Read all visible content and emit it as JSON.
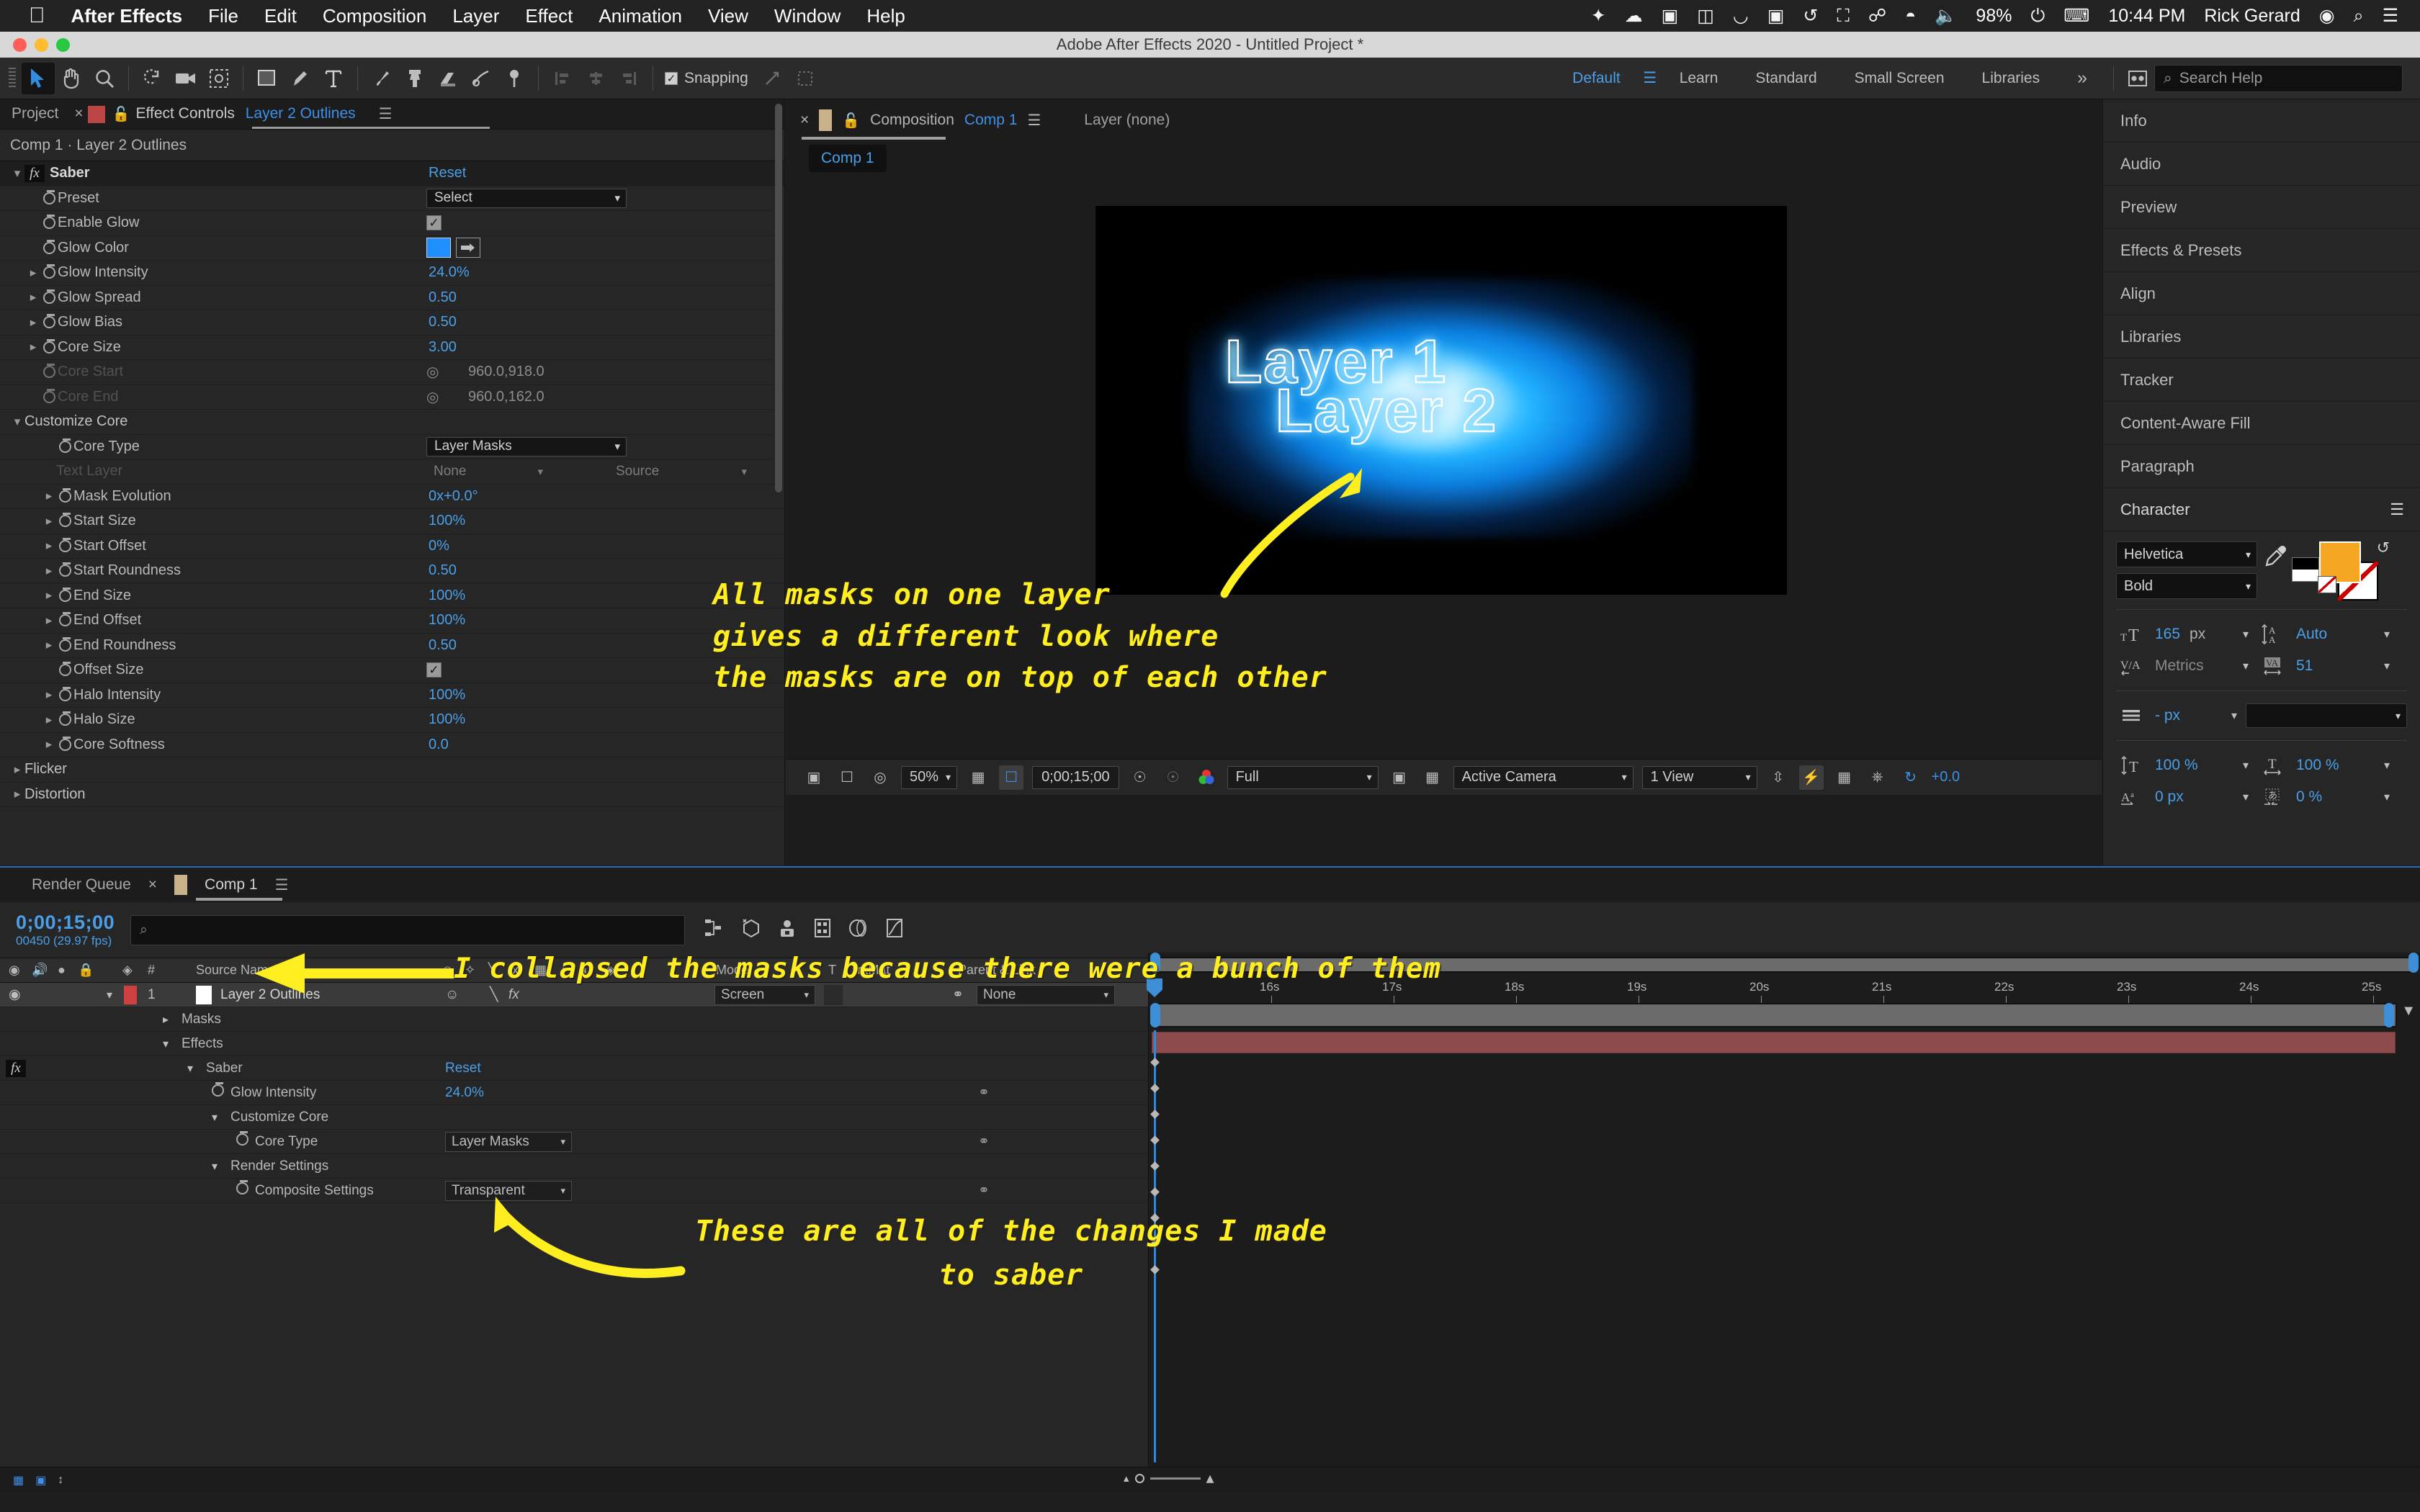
{
  "macbar": {
    "apple_icon": "apple-logo",
    "items": [
      "After Effects",
      "File",
      "Edit",
      "Composition",
      "Layer",
      "Effect",
      "Animation",
      "View",
      "Window",
      "Help"
    ],
    "right_icons": [
      "dropbox-icon",
      "creative-cloud-icon",
      "blackmagic-icon",
      "battery-gauge-icon",
      "wacom-icon",
      "display-icon",
      "timemachine-icon",
      "airplay-icon",
      "bluetooth-icon",
      "wifi-icon",
      "volume-icon"
    ],
    "battery": "98%",
    "battery_charging_icon": "battery-charging-icon",
    "keyboard_icon": "keyboard-icon",
    "time": "10:44 PM",
    "user": "Rick Gerard",
    "siri_icon": "siri-icon",
    "spotlight_icon": "search-icon",
    "controlcenter_icon": "control-center-icon"
  },
  "titlebar": {
    "title": "Adobe After Effects 2020 - Untitled Project *"
  },
  "toolbar": {
    "tools": [
      "selection-tool",
      "hand-tool",
      "zoom-tool",
      "rotation-tool",
      "camera-tool",
      "pan-behind-tool",
      "shape-tool",
      "pen-tool",
      "type-tool",
      "brush-tool",
      "clone-stamp-tool",
      "eraser-tool",
      "roto-brush-tool",
      "puppet-pin-tool"
    ],
    "snapping_label": "Snapping",
    "snapping_checked": true,
    "workspaces": [
      "Default",
      "Learn",
      "Standard",
      "Small Screen",
      "Libraries"
    ],
    "active_workspace": "Default",
    "overflow_label": "»",
    "workspace_menu_icon": "workspace-menu-icon",
    "search_placeholder": "Search Help"
  },
  "effect_controls": {
    "tabs": [
      {
        "label": "Project",
        "closable": false,
        "active": false
      },
      {
        "label": "Effect Controls Layer 2 Outlines",
        "closable": true,
        "active": true,
        "highlight": "Layer 2 Outlines"
      }
    ],
    "subtitle": "Comp 1 · Layer 2 Outlines",
    "rows": [
      {
        "indent": 0,
        "twirl": "down",
        "fx": true,
        "name": "Saber",
        "value": "Reset",
        "value_kind": "reset",
        "header": true
      },
      {
        "indent": 1,
        "stopwatch": true,
        "name": "Preset",
        "control": "select",
        "value": "Select"
      },
      {
        "indent": 1,
        "stopwatch": true,
        "name": "Enable Glow",
        "control": "checkbox",
        "checked": true
      },
      {
        "indent": 1,
        "stopwatch": true,
        "name": "Glow Color",
        "control": "color",
        "color": "#1f8fff"
      },
      {
        "indent": 1,
        "twirl": "right",
        "stopwatch": true,
        "name": "Glow Intensity",
        "value": "24.0%"
      },
      {
        "indent": 1,
        "twirl": "right",
        "stopwatch": true,
        "name": "Glow Spread",
        "value": "0.50"
      },
      {
        "indent": 1,
        "twirl": "right",
        "stopwatch": true,
        "name": "Glow Bias",
        "value": "0.50"
      },
      {
        "indent": 1,
        "twirl": "right",
        "stopwatch": true,
        "name": "Core Size",
        "value": "3.00"
      },
      {
        "indent": 1,
        "stopwatch": true,
        "name": "Core Start",
        "value": "960.0,918.0",
        "dim": true,
        "point": true
      },
      {
        "indent": 1,
        "stopwatch": true,
        "name": "Core End",
        "value": "960.0,162.0",
        "dim": true,
        "point": true
      },
      {
        "indent": 0,
        "twirl": "down",
        "name": "Customize Core",
        "group": true
      },
      {
        "indent": 2,
        "stopwatch": true,
        "name": "Core Type",
        "control": "select",
        "value": "Layer Masks"
      },
      {
        "indent": 2,
        "name": "Text Layer",
        "control": "dual-select",
        "value": "None",
        "value2": "Source",
        "dim": true
      },
      {
        "indent": 2,
        "twirl": "right",
        "stopwatch": true,
        "name": "Mask Evolution",
        "value": "0x+0.0°"
      },
      {
        "indent": 2,
        "twirl": "right",
        "stopwatch": true,
        "name": "Start Size",
        "value": "100%"
      },
      {
        "indent": 2,
        "twirl": "right",
        "stopwatch": true,
        "name": "Start Offset",
        "value": "0%"
      },
      {
        "indent": 2,
        "twirl": "right",
        "stopwatch": true,
        "name": "Start Roundness",
        "value": "0.50"
      },
      {
        "indent": 2,
        "twirl": "right",
        "stopwatch": true,
        "name": "End Size",
        "value": "100%"
      },
      {
        "indent": 2,
        "twirl": "right",
        "stopwatch": true,
        "name": "End Offset",
        "value": "100%"
      },
      {
        "indent": 2,
        "twirl": "right",
        "stopwatch": true,
        "name": "End Roundness",
        "value": "0.50"
      },
      {
        "indent": 2,
        "stopwatch": true,
        "name": "Offset Size",
        "control": "checkbox",
        "checked": true
      },
      {
        "indent": 2,
        "twirl": "right",
        "stopwatch": true,
        "name": "Halo Intensity",
        "value": "100%"
      },
      {
        "indent": 2,
        "twirl": "right",
        "stopwatch": true,
        "name": "Halo Size",
        "value": "100%"
      },
      {
        "indent": 2,
        "twirl": "right",
        "stopwatch": true,
        "name": "Core Softness",
        "value": "0.0"
      },
      {
        "indent": 0,
        "twirl": "right",
        "name": "Flicker",
        "group": true
      },
      {
        "indent": 0,
        "twirl": "right",
        "name": "Distortion",
        "group": true
      }
    ]
  },
  "composition": {
    "tab_close_icon": "close-icon",
    "tab_color_icon": "comp-color-swatch",
    "lock_icon": "lock-icon",
    "tab_label": "Composition",
    "tab_comp_name": "Comp 1",
    "tab_menu_icon": "panel-menu-icon",
    "layer_tab": "Layer (none)",
    "breadcrumb_pill": "Comp 1",
    "viewer_text_line1": "Layer 1",
    "viewer_text_line2": "Layer 2",
    "bottom_bar": {
      "toggle_icons": [
        "always-preview-icon",
        "render-toggle-icon",
        "region-of-interest-icon"
      ],
      "magnification": "50%",
      "grid_icon": "grid-guides-icon",
      "roi_icon": "region-of-interest-icon",
      "timecode": "0;00;15;00",
      "snapshot_icon": "snapshot-icon",
      "show_snapshot_icon": "show-snapshot-icon",
      "channels_icon": "show-channel-icon",
      "resolution": "Full",
      "transparency_icon": "transparency-grid-icon",
      "mask_icon": "mask-overlay-icon",
      "camera": "Active Camera",
      "views": "1 View",
      "pixel_aspect_icon": "pixel-aspect-icon",
      "fast_previews_icon": "fast-previews-icon",
      "timeline_icon": "timeline-icon",
      "comp_flowchart_icon": "comp-flowchart-icon",
      "reset_exposure_icon": "reset-exposure-icon",
      "exposure": "+0.0"
    }
  },
  "right_panels": {
    "items": [
      "Info",
      "Audio",
      "Preview",
      "Effects & Presets",
      "Align",
      "Libraries",
      "Tracker",
      "Content-Aware Fill",
      "Paragraph"
    ],
    "character": {
      "title": "Character",
      "menu_icon": "panel-menu-icon",
      "font_family": "Helvetica",
      "font_style": "Bold",
      "eyedropper_icon": "eyedropper-icon",
      "swap_icon": "swap-fill-stroke-icon",
      "fill_color": "#f5a623",
      "font_size": "165",
      "font_size_unit": "px",
      "font_size_icon": "font-size-icon",
      "leading": "Auto",
      "leading_icon": "leading-icon",
      "kerning": "Metrics",
      "kerning_icon": "kerning-icon",
      "tracking": "51",
      "tracking_icon": "tracking-icon",
      "stroke_width": "- px",
      "stroke_width_icon": "stroke-width-icon",
      "stroke_type": "",
      "vertical_scale": "100 %",
      "vertical_scale_icon": "vertical-scale-icon",
      "horizontal_scale": "100 %",
      "horizontal_scale_icon": "horizontal-scale-icon",
      "baseline_shift": "0 px",
      "baseline_shift_icon": "baseline-shift-icon",
      "tsume": "0 %",
      "tsume_icon": "tsume-icon"
    }
  },
  "timeline": {
    "tabs": [
      {
        "label": "Render Queue",
        "active": false
      },
      {
        "label": "Comp 1",
        "active": true,
        "closable": true
      }
    ],
    "tab_menu_icon": "panel-menu-icon",
    "current_time": "0;00;15;00",
    "frame_info": "00450 (29.97 fps)",
    "search_icon": "search-icon",
    "toolbar_icons": [
      "composition-mini-flowchart-icon",
      "draft-3d-icon",
      "hide-shy-layers-icon",
      "frame-blending-icon",
      "motion-blur-icon",
      "graph-editor-icon"
    ],
    "columns": [
      "Source Name",
      "Mode",
      "T",
      "TrkMat",
      "Parent & Link"
    ],
    "col_icons": [
      "video-toggle-icon",
      "audio-toggle-icon",
      "solo-icon",
      "lock-icon",
      "label-icon",
      "number-icon",
      "shy-icon",
      "collapse-icon",
      "quality-icon",
      "effects-icon",
      "frame-blend-icon",
      "motion-blur-icon",
      "adjustment-icon",
      "3d-layer-icon"
    ],
    "rows": [
      {
        "indent": 0,
        "kind": "layer",
        "number": "1",
        "name": "Layer 2 Outlines",
        "mode": "Screen",
        "parent": "None",
        "selected": true,
        "twirl": "down"
      },
      {
        "indent": 3,
        "kind": "group",
        "name": "Masks",
        "twirl": "right"
      },
      {
        "indent": 3,
        "kind": "group",
        "name": "Effects",
        "twirl": "down"
      },
      {
        "indent": 4,
        "kind": "effect",
        "name": "Saber",
        "value": "Reset",
        "value_kind": "reset",
        "twirl": "down",
        "fx": true
      },
      {
        "indent": 5,
        "kind": "prop",
        "name": "Glow Intensity",
        "value": "24.0%",
        "stopwatch": true,
        "link": true
      },
      {
        "indent": 5,
        "kind": "group",
        "name": "Customize Core",
        "twirl": "down"
      },
      {
        "indent": 6,
        "kind": "prop",
        "name": "Core Type",
        "control": "select",
        "value": "Layer Masks",
        "stopwatch": true,
        "link": true
      },
      {
        "indent": 5,
        "kind": "group",
        "name": "Render Settings",
        "twirl": "down"
      },
      {
        "indent": 6,
        "kind": "prop",
        "name": "Composite Settings",
        "control": "select",
        "value": "Transparent",
        "stopwatch": true,
        "link": true
      }
    ],
    "ruler_ticks": [
      "16s",
      "17s",
      "18s",
      "19s",
      "20s",
      "21s",
      "22s",
      "23s",
      "24s",
      "25s"
    ],
    "status_icons": [
      "toggle-switches-modes-icon",
      "graph-editor-icon",
      "stretch-icon"
    ],
    "zoom_out_icon": "zoom-out-icon",
    "zoom_in_icon": "zoom-in-icon"
  },
  "annotations": {
    "a1_line1": "All masks on one layer",
    "a1_line2": "gives a different look where",
    "a1_line3": "the masks are on top of each other",
    "a2": "I collapsed the masks because there were a bunch of them",
    "a3_line1": "These are all of the changes I made",
    "a3_line2": "to saber",
    "color": "#ffef20"
  }
}
